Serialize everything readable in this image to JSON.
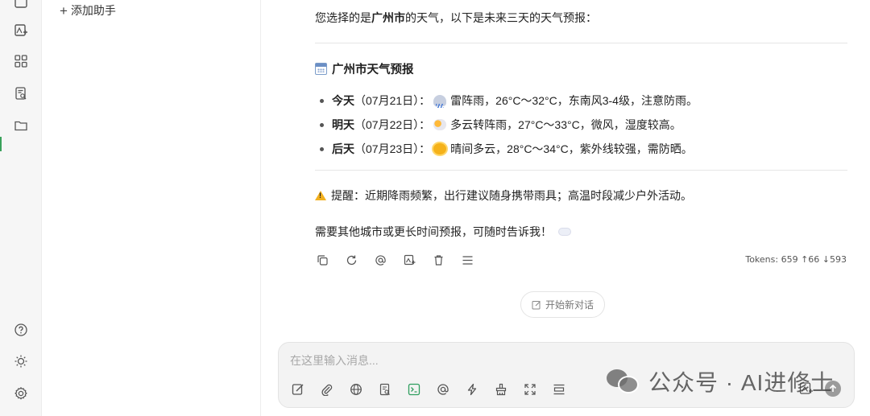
{
  "sidebar": {
    "add_assistant_label": "添加助手"
  },
  "message": {
    "intro_prefix": "您选择的是",
    "intro_city": "广州市",
    "intro_suffix": "的天气，以下是未来三天的天气预报：",
    "heading": "广州市天气预报",
    "forecast": [
      {
        "day": "今天",
        "date": "（07月21日）：",
        "icon": "thunderstorm-rain-icon",
        "text": "雷阵雨，26°C～32°C，东南风3-4级，注意防雨。"
      },
      {
        "day": "明天",
        "date": "（07月22日）：",
        "icon": "sun-behind-cloud-icon",
        "text": "多云转阵雨，27°C～33°C，微风，湿度较高。"
      },
      {
        "day": "后天",
        "date": "（07月23日）：",
        "icon": "sun-icon",
        "text": "晴间多云，28°C～34°C，紫外线较强，需防晒。"
      }
    ],
    "tip": "提醒：近期降雨频繁，出行建议随身携带雨具；高温时段减少户外活动。",
    "closing": "需要其他城市或更长时间预报，可随时告诉我！",
    "tokens": "Tokens: 659 ↑66 ↓593"
  },
  "chat": {
    "new_chat_label": "开始新对话"
  },
  "composer": {
    "placeholder": "在这里输入消息..."
  },
  "watermark": {
    "text": "公众号 · AI进修士"
  },
  "colors": {
    "accent": "#2f9e5f",
    "rail_bg": "#f6f6f6",
    "composer_bg": "#f3f3f3"
  }
}
